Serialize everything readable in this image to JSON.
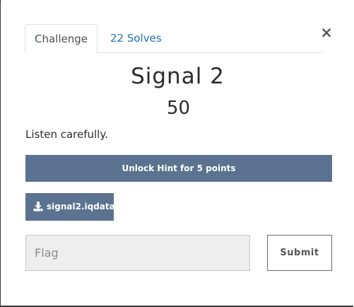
{
  "modal": {
    "tabs": [
      {
        "label": "Challenge",
        "active": true
      },
      {
        "label": "22 Solves",
        "active": false
      }
    ],
    "close_symbol": "×",
    "title": "Signal 2",
    "points": "50",
    "description": "Listen carefully.",
    "hint_button_label": "Unlock Hint for 5 points",
    "file": {
      "name": "signal2.iqdata",
      "icon": "download-icon"
    },
    "flag_input": {
      "placeholder": "Flag",
      "value": ""
    },
    "submit_label": "Submit"
  },
  "colors": {
    "accent_button": "#5b7290",
    "tab_link": "#2470b5",
    "input_background": "#eeeeee"
  }
}
